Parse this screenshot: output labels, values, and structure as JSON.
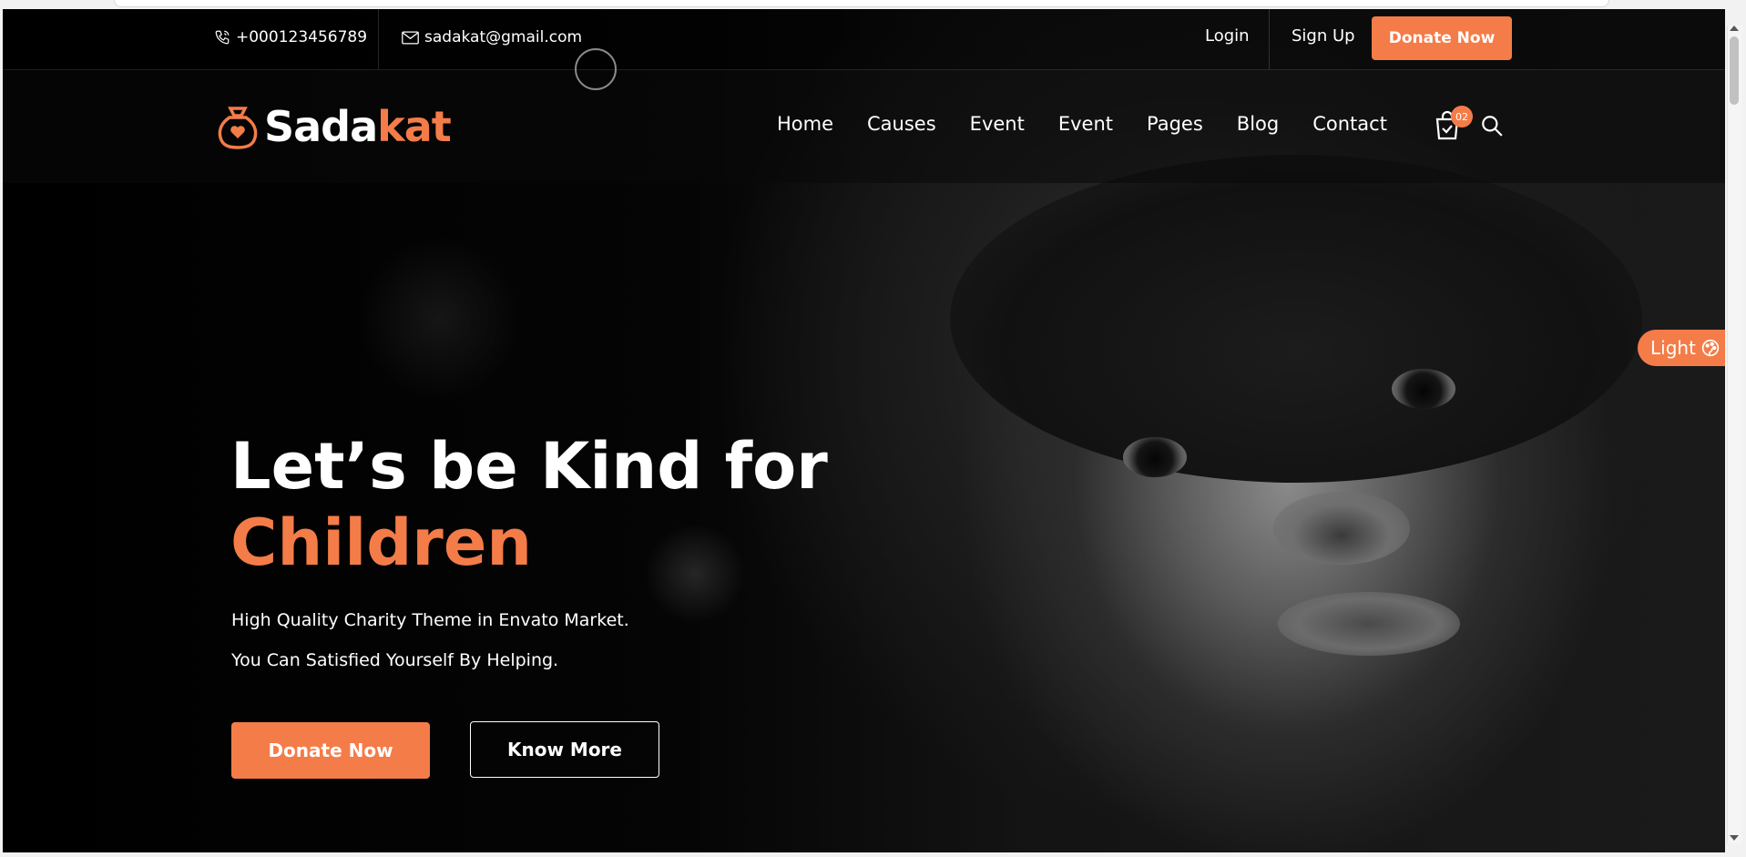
{
  "topbar": {
    "phone": "+000123456789",
    "email": "sadakat@gmail.com",
    "login": "Login",
    "signup": "Sign Up",
    "donate": "Donate Now"
  },
  "brand": {
    "name_main": "Sada",
    "name_accent": "kat"
  },
  "nav": {
    "items": [
      "Home",
      "Causes",
      "Event",
      "Event",
      "Pages",
      "Blog",
      "Contact"
    ],
    "cart_count": "02"
  },
  "hero": {
    "title_line1": "Let’s be Kind for",
    "title_line2": "Children",
    "sub1": "High Quality Charity Theme in Envato Market.",
    "sub2": "You Can Satisfied Yourself By Helping.",
    "donate": "Donate Now",
    "know_more": "Know More"
  },
  "theme_toggle": {
    "label": "Light"
  },
  "colors": {
    "accent": "#f47c48",
    "background": "#000000",
    "text": "#ffffff"
  },
  "icons": [
    "phone-icon",
    "mail-icon",
    "logo-bag-heart-icon",
    "cart-icon",
    "search-icon",
    "palette-icon"
  ]
}
